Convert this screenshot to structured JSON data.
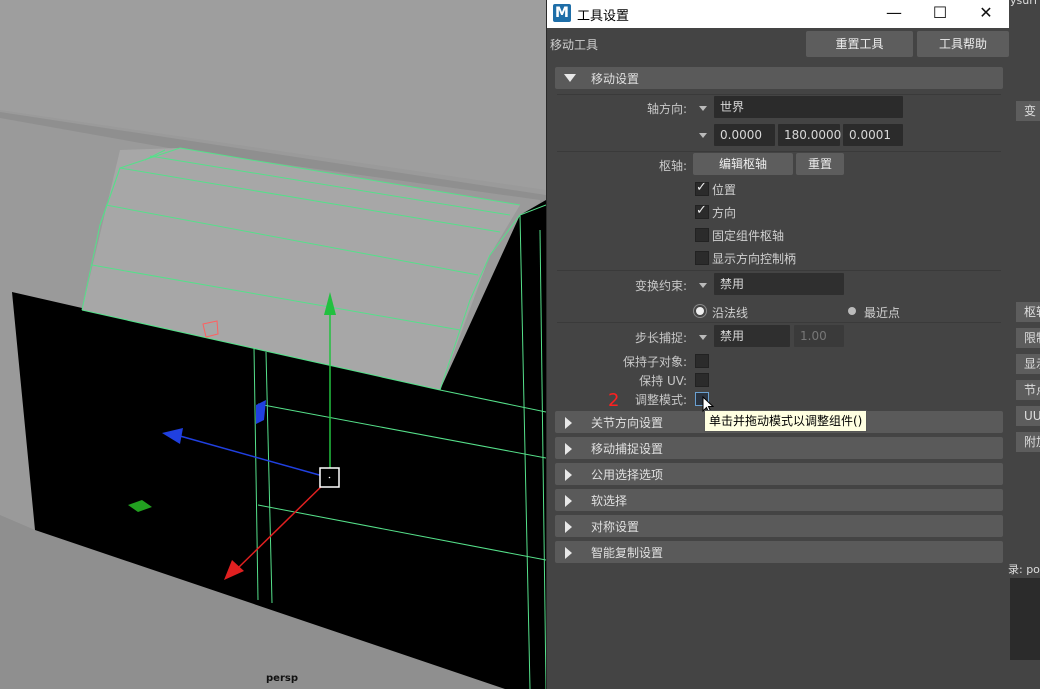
{
  "viewport": {
    "camera_label": "persp"
  },
  "window": {
    "app_icon": "M",
    "title": "工具设置",
    "tool_name": "移动工具",
    "reset_tool": "重置工具",
    "tool_help": "工具帮助"
  },
  "move_settings": {
    "header": "移动设置",
    "axis_orient_label": "轴方向:",
    "axis_orient_value": "世界",
    "rot_x": "0.0000",
    "rot_y": "180.0000",
    "rot_z": "0.0001",
    "pivot_label": "枢轴:",
    "edit_pivot": "编辑枢轴",
    "reset": "重置",
    "position": "位置",
    "orientation": "方向",
    "pin_component_pivot": "固定组件枢轴",
    "show_orient_handle": "显示方向控制柄",
    "transform_constraint_label": "变换约束:",
    "transform_constraint_value": "禁用",
    "along_normal": "沿法线",
    "closest_point": "最近点",
    "step_snap_label": "步长捕捉:",
    "step_snap_value": "禁用",
    "step_snap_amount": "1.00",
    "preserve_children_label": "保持子对象:",
    "preserve_uv_label": "保持 UV:",
    "tweak_mode_label": "调整模式:"
  },
  "tooltip": "单击并拖动模式以调整组件()",
  "annotation": "2",
  "collapsed_sections": [
    "关节方向设置",
    "移动捕捉设置",
    "公用选择选项",
    "软选择",
    "对称设置",
    "智能复制设置"
  ],
  "bg_panel": {
    "top_text": "ysurf",
    "tabs": [
      "变",
      "枢轴",
      "限制",
      "显示",
      "节点",
      "UU",
      "附加"
    ],
    "bottom_label": "录: po"
  },
  "colors": {
    "wireframe": "#55e08a",
    "x_axis": "#e02020",
    "y_axis": "#22c040",
    "z_axis": "#2040e0"
  }
}
